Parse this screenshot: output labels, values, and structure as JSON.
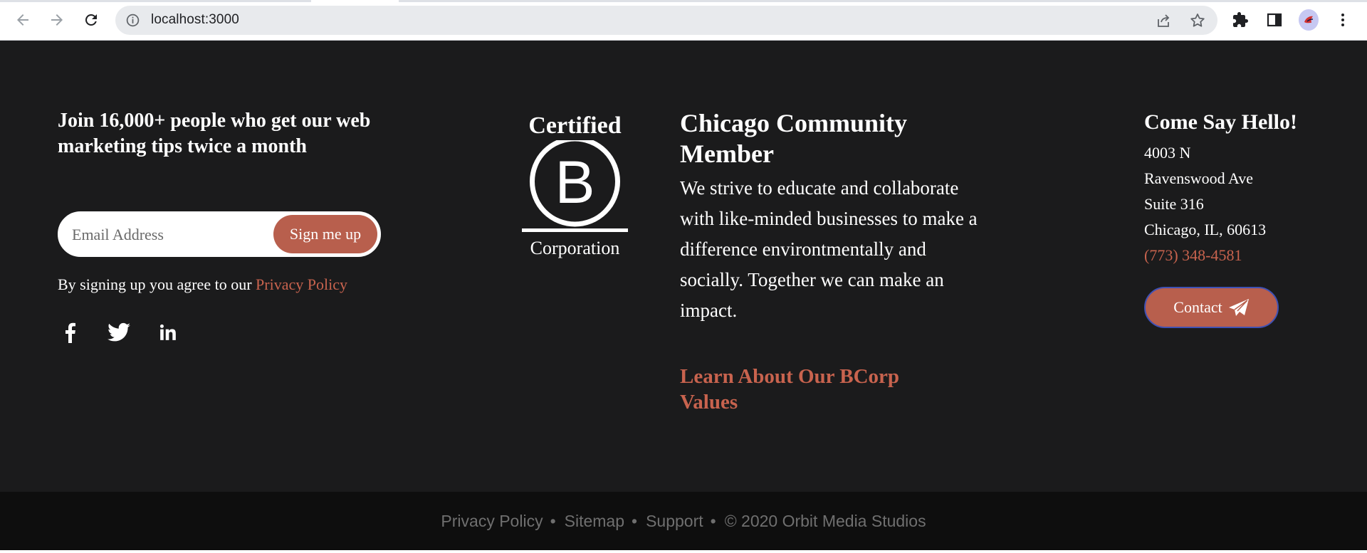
{
  "browser": {
    "url": "localhost:3000",
    "icons": [
      "back-arrow-icon",
      "forward-arrow-icon",
      "reload-icon",
      "info-icon",
      "share-icon",
      "star-icon",
      "extensions-icon",
      "side-panel-icon",
      "profile-avatar",
      "more-vert-icon"
    ]
  },
  "newsletter": {
    "heading": "Join 16,000+ people who get our web marketing tips twice a month",
    "email_placeholder": "Email Address",
    "signup_label": "Sign me up",
    "consent_text": "By signing up you agree to our ",
    "privacy_link": "Privacy Policy",
    "socials": [
      "facebook-icon",
      "twitter-icon",
      "linkedin-icon"
    ]
  },
  "bcorp": {
    "certified": "Certified",
    "letter": "B",
    "corporation": "Corporation"
  },
  "community": {
    "title": "Chicago Community Member",
    "body": "We strive to educate and collaborate with like-minded businesses to make a difference environtmentally and socially. Together we can make an impact.",
    "link": "Learn About Our BCorp Values"
  },
  "contact": {
    "title": "Come Say Hello!",
    "address": [
      "4003 N",
      "Ravenswood Ave",
      "Suite 316",
      "Chicago, IL, 60613"
    ],
    "phone": "(773) 348-4581",
    "button_label": "Contact"
  },
  "bottom_bar": {
    "links": [
      "Privacy Policy",
      "Sitemap",
      "Support"
    ],
    "separator": "•",
    "copyright": "© 2020 Orbit Media Studios"
  },
  "colors": {
    "footer_bg": "#1b1b1c",
    "bottom_bg": "#0e0e0e",
    "accent": "#b85f4d",
    "link": "#c8634e"
  }
}
